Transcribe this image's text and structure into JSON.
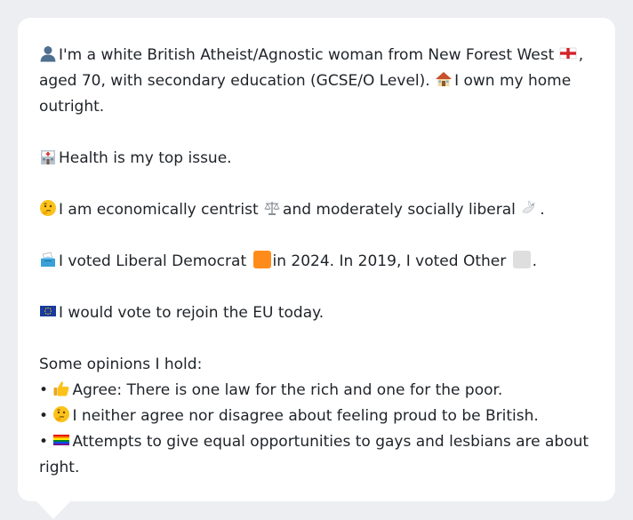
{
  "profile": {
    "intro_1": "I'm a white British Atheist/Agnostic woman from New Forest West",
    "intro_2": ", aged 70, with secondary education (GCSE/O Level).",
    "intro_3": "I own my home outright.",
    "health": "Health is my top issue.",
    "econ_1": "I am economically centrist",
    "econ_2": "and moderately socially liberal",
    "econ_3": ".",
    "vote_1": "I voted Liberal Democrat",
    "vote_2": "in 2024. In 2019, I voted Other",
    "vote_3": ".",
    "eu": "I would vote to rejoin the EU today.",
    "opinions_header": "Some opinions I hold:",
    "bullet": "•",
    "opinions": [
      "Agree: There is one law for the rich and one for the poor.",
      "I neither agree nor disagree about feeling proud to be British.",
      "Attempts to give equal opportunities to gays and lesbians are about right."
    ]
  },
  "colors": {
    "libdem": "#ff8c1a",
    "other": "#dedede",
    "bubble_bg": "#ffffff",
    "page_bg": "#eceef1",
    "text": "#1f2328"
  },
  "icons": {
    "person": "bust-in-silhouette-icon",
    "flag": "england-flag-icon",
    "home": "house-icon",
    "health": "hospital-icon",
    "thinking": "thinking-face-icon",
    "scales": "balance-scale-icon",
    "dove": "dove-icon",
    "ballot": "ballot-box-icon",
    "eu": "eu-flag-icon",
    "thumbs": "thumbs-up-icon",
    "rainbow": "rainbow-flag-icon"
  }
}
